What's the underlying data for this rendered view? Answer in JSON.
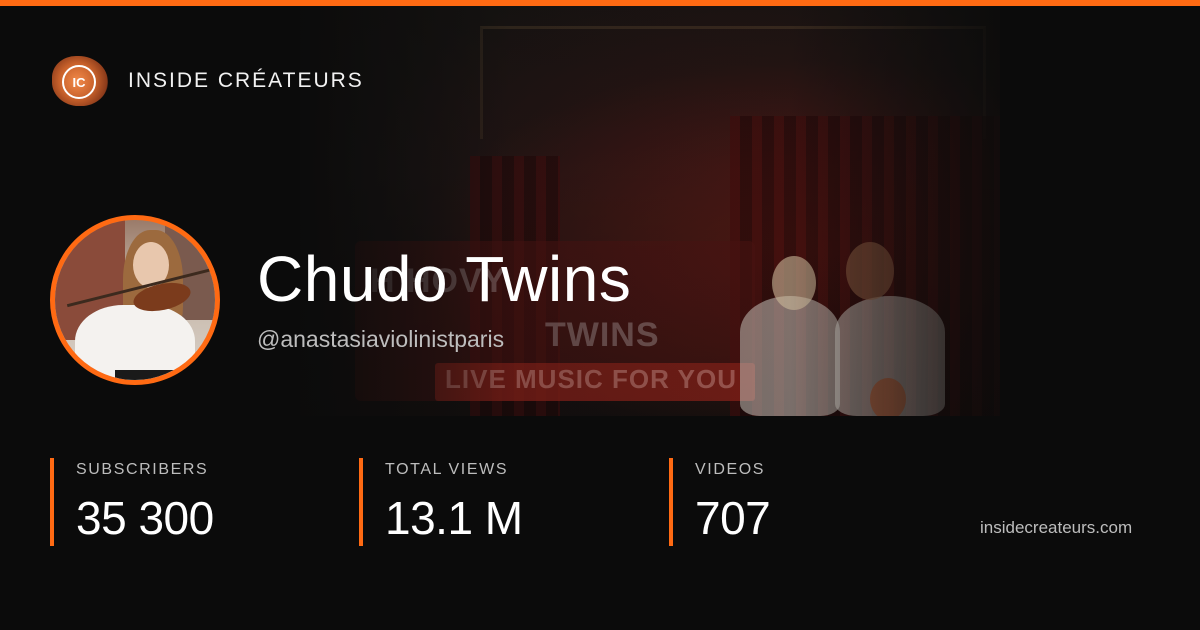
{
  "brand": {
    "logo_text": "IC",
    "name": "INSIDE CRÉATEURS"
  },
  "banner": {
    "sign_line1": "H     HOVY",
    "sign_line2": "TWINS",
    "sign_line3": "LIVE MUSIC FOR YOU"
  },
  "channel": {
    "name": "Chudo Twins",
    "handle": "@anastasiaviolinistparis"
  },
  "stats": [
    {
      "label": "SUBSCRIBERS",
      "value": "35 300"
    },
    {
      "label": "TOTAL VIEWS",
      "value": "13.1 M"
    },
    {
      "label": "VIDEOS",
      "value": "707"
    }
  ],
  "site": "insidecreateurs.com",
  "colors": {
    "accent": "#ff6a13",
    "background": "#0b0b0b",
    "text_primary": "#ffffff",
    "text_secondary": "#bdbdbd"
  }
}
